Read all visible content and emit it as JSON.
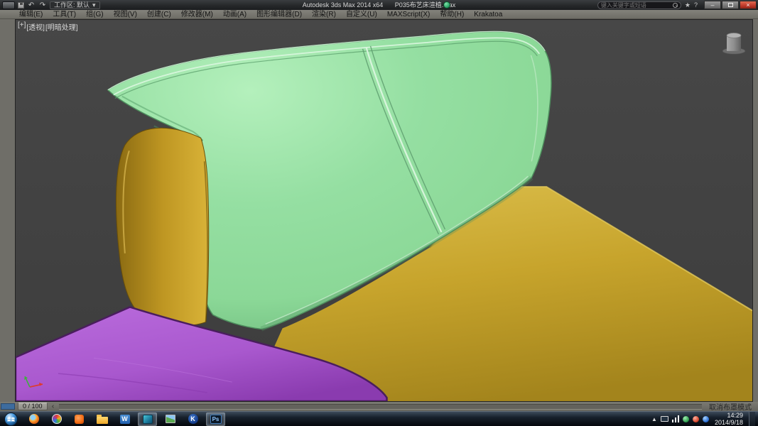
{
  "window": {
    "app_title": "Autodesk 3ds Max  2014 x64",
    "file_name": "P035布艺床渲植.max",
    "workspace_label": "工作区: 默认",
    "dropdown_glyph": "▾",
    "undo_glyph": "↶",
    "redo_glyph": "↷",
    "search_placeholder": "键入关键字或短语",
    "star_glyph": "★",
    "help_glyph": "?",
    "minimize_glyph": "–",
    "close_glyph": "×"
  },
  "menu_bar": {
    "items": [
      "编辑(E)",
      "工具(T)",
      "组(G)",
      "视图(V)",
      "创建(C)",
      "修改器(M)",
      "动画(A)",
      "图形编辑器(D)",
      "渲染(R)",
      "自定义(U)",
      "MAXScript(X)",
      "帮助(H)",
      "Krakatoa"
    ]
  },
  "viewport": {
    "label_plus": "[+]",
    "label_view": "[透视]",
    "label_shading": "[明暗处理]"
  },
  "timeline": {
    "frame_label": "0 / 100",
    "prev_glyph": "‹",
    "status_message": "取消布罩模式"
  },
  "taskbar": {
    "icons": [
      {
        "name": "firefox"
      },
      {
        "name": "browser-360"
      },
      {
        "name": "media-player"
      },
      {
        "name": "folder-explorer"
      },
      {
        "name": "word",
        "glyph": "W"
      },
      {
        "name": "3ds-max",
        "active": true
      },
      {
        "name": "image-viewer"
      },
      {
        "name": "krakatoa",
        "glyph": "K"
      },
      {
        "name": "photoshop",
        "glyph": "Ps",
        "active": true
      }
    ],
    "tray": {
      "hidden_glyph": "▲",
      "time": "14:29",
      "date": "2014/9/18"
    }
  },
  "colors": {
    "green-main": "#8BD897",
    "green-light": "#B4F0BC",
    "green-dark": "#63AE73",
    "green-outline": "#4E8F5E",
    "green-seam-light": "#DCF6E0",
    "bed-yellow": "#C7A42C",
    "bed-yellow-light": "#D9BC49",
    "bed-yellow-dark": "#A3841C",
    "pillow-light": "#D9B338",
    "pillow-dark": "#8A6A12",
    "purple-main": "#A958CE",
    "purple-dark": "#8A3BAF",
    "purple-outline": "#4A1D5E",
    "viewport-bg": "#3D3D3D",
    "a360-green": "#2FA86B",
    "accent-close": "#C0392B"
  }
}
